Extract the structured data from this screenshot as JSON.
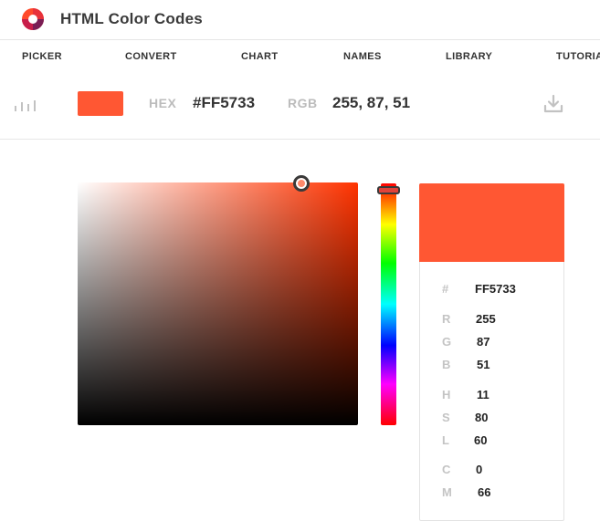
{
  "header": {
    "title": "HTML Color Codes",
    "logo_icon": "color-wheel-logo"
  },
  "nav": {
    "items": [
      {
        "label": "PICKER"
      },
      {
        "label": "CONVERT"
      },
      {
        "label": "CHART"
      },
      {
        "label": "NAMES"
      },
      {
        "label": "LIBRARY"
      },
      {
        "label": "TUTORIA"
      }
    ]
  },
  "colorbar": {
    "color": "#FF5733",
    "hex_label": "HEX",
    "hex_value": "#FF5733",
    "rgb_label": "RGB",
    "rgb_value": "255, 87, 51",
    "bars_icon": "bar-chart-icon",
    "download_icon": "download-icon"
  },
  "picker": {
    "hue_color": "#FF3300",
    "saturation_level": 0.8,
    "brightness_level": 1.0,
    "hue_level": 0.03
  },
  "details": {
    "swatch_color": "#FF5733",
    "rows": [
      {
        "key": "#",
        "value": "FF5733"
      },
      {
        "key": "R",
        "value": "255"
      },
      {
        "key": "G",
        "value": "87"
      },
      {
        "key": "B",
        "value": "51"
      },
      {
        "key": "H",
        "value": "11"
      },
      {
        "key": "S",
        "value": "80"
      },
      {
        "key": "L",
        "value": "60"
      },
      {
        "key": "C",
        "value": "0"
      },
      {
        "key": "M",
        "value": "66"
      }
    ]
  },
  "colors": {
    "accent": "#FF5733",
    "text": "#333333",
    "muted": "#BCBCBC",
    "divider": "#E6E6E6"
  }
}
